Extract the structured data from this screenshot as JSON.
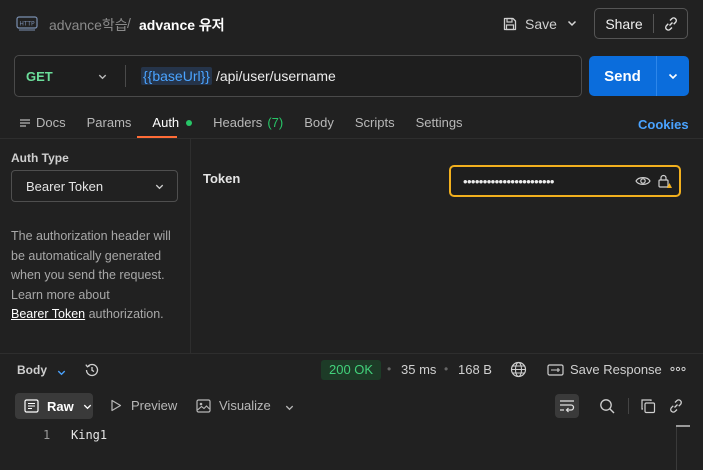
{
  "header": {
    "app_icon": "http-request-icon",
    "app_icon_text": "HTTP",
    "breadcrumb_parent": "advance학습",
    "breadcrumb_sep": "/",
    "request_title": "advance 유저",
    "save_label": "Save",
    "share_label": "Share"
  },
  "request": {
    "method": "GET",
    "url_variable": "{{baseUrl}}",
    "url_path": "/api/user/username",
    "send_label": "Send"
  },
  "tabs": {
    "docs": "Docs",
    "params": "Params",
    "auth": "Auth",
    "headers": "Headers",
    "headers_count": "(7)",
    "body": "Body",
    "scripts": "Scripts",
    "settings": "Settings",
    "active": "Auth",
    "cookies": "Cookies"
  },
  "auth": {
    "type_label": "Auth Type",
    "type_value": "Bearer Token",
    "description": "The authorization header will be automatically generated when you send the request. Learn more about",
    "link_text": "Bearer Token",
    "link_suffix": " authorization.",
    "token_label": "Token",
    "token_masked": "•••••••••••••••••••••••"
  },
  "response": {
    "body_label": "Body",
    "status": "200 OK",
    "time": "35 ms",
    "size": "168 B",
    "save_response": "Save Response",
    "sep": "•",
    "view_raw": "Raw",
    "view_preview": "Preview",
    "view_visualize": "Visualize",
    "lines": [
      {
        "no": "1",
        "text": "King1"
      }
    ]
  },
  "colors": {
    "background": "#212121",
    "send_button": "#0b6ddc",
    "method_get": "#6bdd9a",
    "active_tab_underline": "#ff6c37",
    "status_ok": "#42d17b",
    "token_focus_border": "#f2b01e",
    "link_blue": "#4aa3ff"
  }
}
